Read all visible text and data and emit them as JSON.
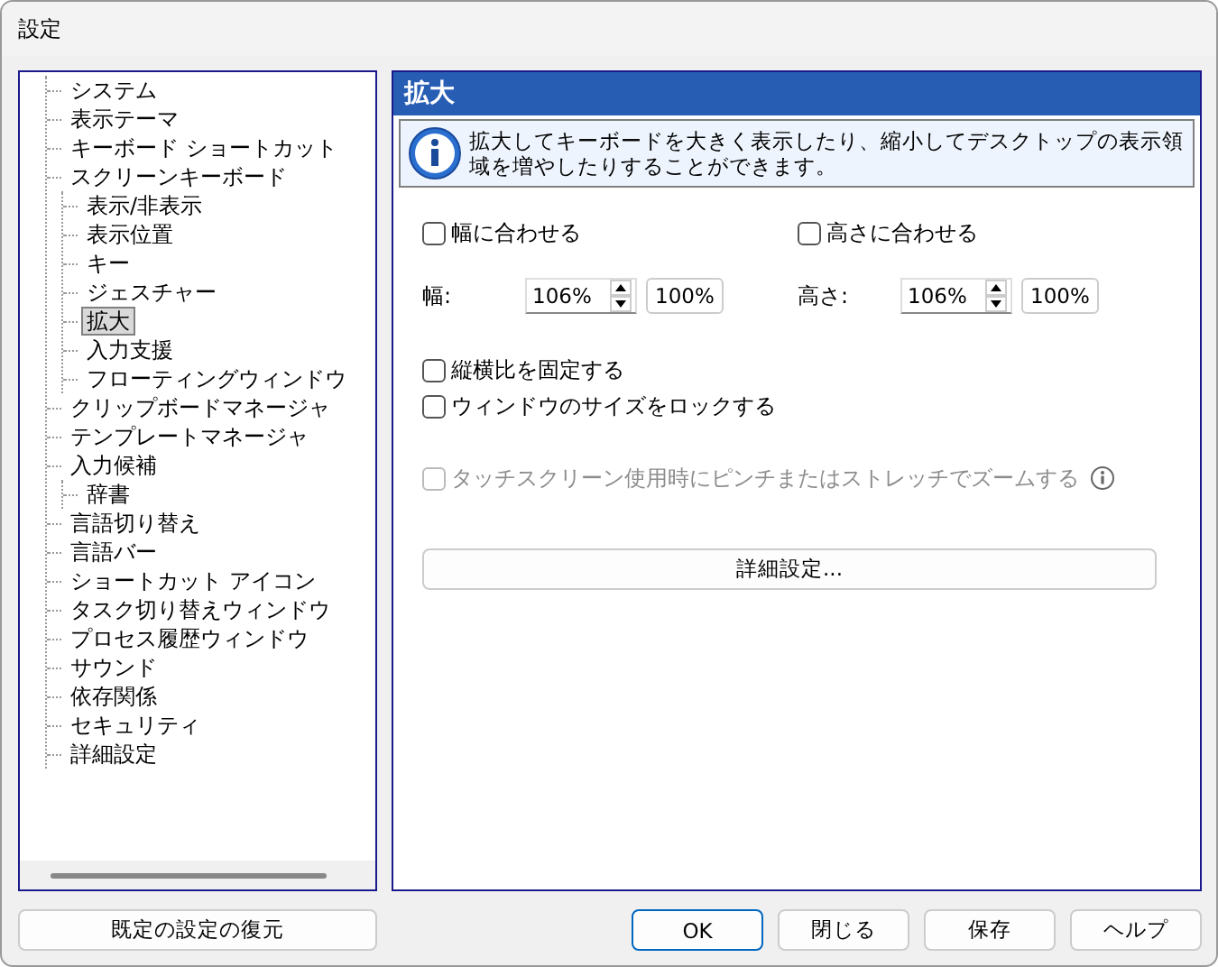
{
  "window": {
    "title": "設定"
  },
  "tree": [
    {
      "label": "システム",
      "selected": false
    },
    {
      "label": "表示テーマ",
      "selected": false
    },
    {
      "label": "キーボード ショートカット",
      "selected": false
    },
    {
      "label": "スクリーンキーボード",
      "selected": false,
      "children": [
        {
          "label": "表示/非表示",
          "selected": false
        },
        {
          "label": "表示位置",
          "selected": false
        },
        {
          "label": "キー",
          "selected": false
        },
        {
          "label": "ジェスチャー",
          "selected": false
        },
        {
          "label": "拡大",
          "selected": true
        },
        {
          "label": "入力支援",
          "selected": false
        },
        {
          "label": "フローティングウィンドウ",
          "selected": false
        }
      ]
    },
    {
      "label": "クリップボードマネージャ",
      "selected": false
    },
    {
      "label": "テンプレートマネージャ",
      "selected": false
    },
    {
      "label": "入力候補",
      "selected": false,
      "children": [
        {
          "label": "辞書",
          "selected": false
        }
      ]
    },
    {
      "label": "言語切り替え",
      "selected": false
    },
    {
      "label": "言語バー",
      "selected": false
    },
    {
      "label": "ショートカット アイコン",
      "selected": false
    },
    {
      "label": "タスク切り替えウィンドウ",
      "selected": false
    },
    {
      "label": "プロセス履歴ウィンドウ",
      "selected": false
    },
    {
      "label": "サウンド",
      "selected": false
    },
    {
      "label": "依存関係",
      "selected": false
    },
    {
      "label": "セキュリティ",
      "selected": false
    },
    {
      "label": "詳細設定",
      "selected": false
    }
  ],
  "restore_button": "既定の設定の復元",
  "panel": {
    "title": "拡大",
    "info": "拡大してキーボードを大きく表示したり、縮小してデスクトップの表示領域を増やしたりすることができます。",
    "fit": [
      {
        "label": "幅に合わせる",
        "checked": false
      },
      {
        "label": "高さに合わせる",
        "checked": false
      }
    ],
    "scales": [
      {
        "label": "幅:",
        "value": "106%",
        "reset": "100%"
      },
      {
        "label": "高さ:",
        "value": "106%",
        "reset": "100%"
      }
    ],
    "locks": [
      {
        "label": "縦横比を固定する",
        "checked": false,
        "disabled": false
      },
      {
        "label": "ウィンドウのサイズをロックする",
        "checked": false,
        "disabled": false
      }
    ],
    "touch_zoom": {
      "label": "タッチスクリーン使用時にピンチまたはストレッチでズームする",
      "checked": false,
      "disabled": true
    },
    "advanced_button": "詳細設定..."
  },
  "buttons": [
    {
      "label": "OK",
      "default": true
    },
    {
      "label": "閉じる",
      "default": false
    },
    {
      "label": "保存",
      "default": false
    },
    {
      "label": "ヘルプ",
      "default": false
    }
  ]
}
